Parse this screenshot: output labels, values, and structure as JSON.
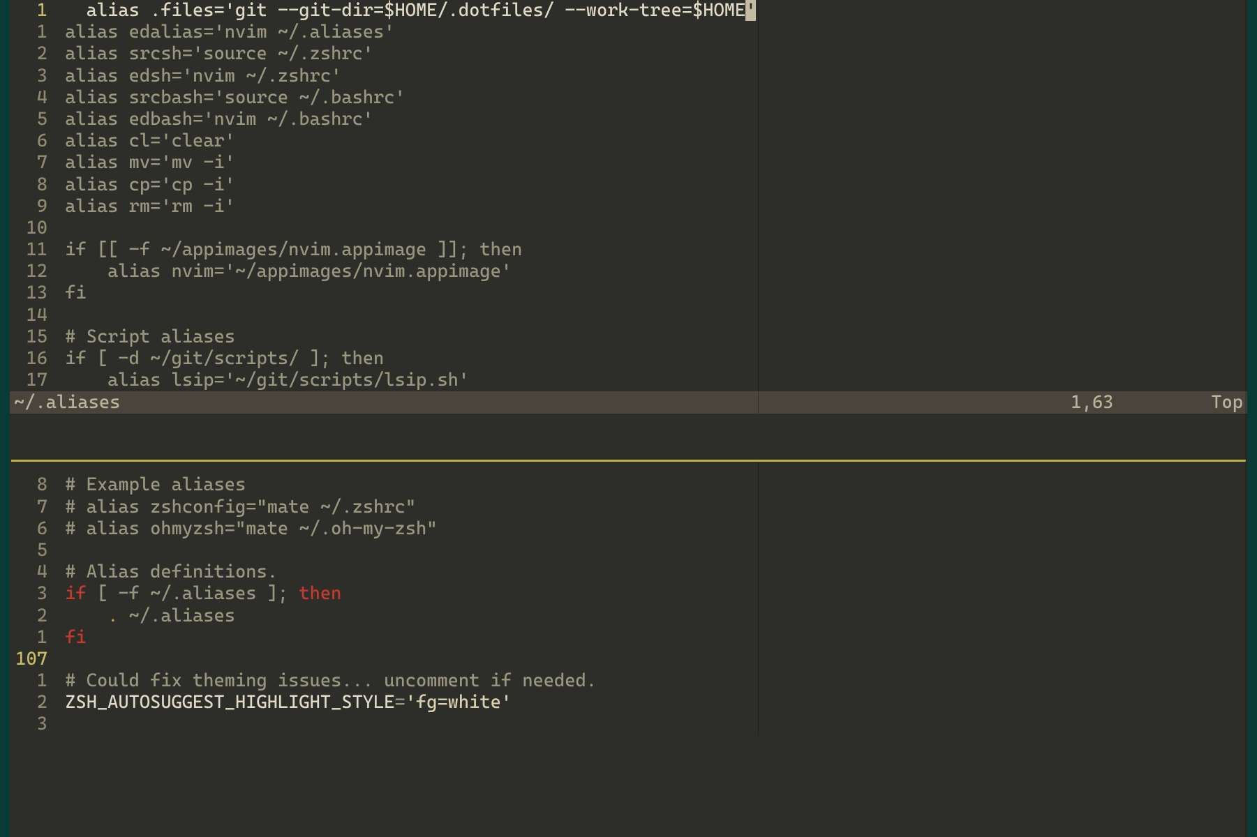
{
  "paneA": {
    "filename": "~/.aliases",
    "cursor": "1,63",
    "scroll": "Top",
    "lines": [
      {
        "gutter": "1",
        "current": true,
        "segments": [
          {
            "t": "alias .files=",
            "c": "bright"
          },
          {
            "t": "'git --git-dir=$HOME/.dotfiles/ --work-tree=$HOME",
            "c": "bright"
          },
          {
            "t": "'",
            "c": "cursor"
          }
        ],
        "indent": "   "
      },
      {
        "gutter": "1",
        "segments": [
          {
            "t": "alias edalias=",
            "c": "dim"
          },
          {
            "t": "'nvim ~/.aliases'",
            "c": "dim"
          }
        ]
      },
      {
        "gutter": "2",
        "segments": [
          {
            "t": "alias srcsh=",
            "c": "dim"
          },
          {
            "t": "'source ~/.zshrc'",
            "c": "dim"
          }
        ]
      },
      {
        "gutter": "3",
        "segments": [
          {
            "t": "alias edsh=",
            "c": "dim"
          },
          {
            "t": "'nvim ~/.zshrc'",
            "c": "dim"
          }
        ]
      },
      {
        "gutter": "4",
        "segments": [
          {
            "t": "alias srcbash=",
            "c": "dim"
          },
          {
            "t": "'source ~/.bashrc'",
            "c": "dim"
          }
        ]
      },
      {
        "gutter": "5",
        "segments": [
          {
            "t": "alias edbash=",
            "c": "dim"
          },
          {
            "t": "'nvim ~/.bashrc'",
            "c": "dim"
          }
        ]
      },
      {
        "gutter": "6",
        "segments": [
          {
            "t": "alias cl=",
            "c": "dim"
          },
          {
            "t": "'clear'",
            "c": "dim"
          }
        ]
      },
      {
        "gutter": "7",
        "segments": [
          {
            "t": "alias mv=",
            "c": "dim"
          },
          {
            "t": "'mv -i'",
            "c": "dim"
          }
        ]
      },
      {
        "gutter": "8",
        "segments": [
          {
            "t": "alias cp=",
            "c": "dim"
          },
          {
            "t": "'cp -i'",
            "c": "dim"
          }
        ]
      },
      {
        "gutter": "9",
        "segments": [
          {
            "t": "alias rm=",
            "c": "dim"
          },
          {
            "t": "'rm -i'",
            "c": "dim"
          }
        ]
      },
      {
        "gutter": "10",
        "segments": []
      },
      {
        "gutter": "11",
        "segments": [
          {
            "t": "if [[ -f ~/appimages/nvim.appimage ]]; then",
            "c": "dim"
          }
        ]
      },
      {
        "gutter": "12",
        "segments": [
          {
            "t": "    alias nvim=",
            "c": "dim"
          },
          {
            "t": "'~/appimages/nvim.appimage'",
            "c": "dim"
          }
        ]
      },
      {
        "gutter": "13",
        "segments": [
          {
            "t": "fi",
            "c": "dim"
          }
        ]
      },
      {
        "gutter": "14",
        "segments": []
      },
      {
        "gutter": "15",
        "segments": [
          {
            "t": "# Script aliases",
            "c": "dim"
          }
        ]
      },
      {
        "gutter": "16",
        "segments": [
          {
            "t": "if [ -d ~/git/scripts/ ]; then",
            "c": "dim"
          }
        ]
      },
      {
        "gutter": "17",
        "segments": [
          {
            "t": "    alias lsip=",
            "c": "dim"
          },
          {
            "t": "'~/git/scripts/lsip.sh'",
            "c": "dim"
          }
        ]
      }
    ]
  },
  "paneB": {
    "lines": [
      {
        "gutter": "8",
        "segments": [
          {
            "t": "# Example aliases",
            "c": "dim"
          }
        ]
      },
      {
        "gutter": "7",
        "segments": [
          {
            "t": "# alias zshconfig=\"mate ~/.zshrc\"",
            "c": "dim"
          }
        ]
      },
      {
        "gutter": "6",
        "segments": [
          {
            "t": "# alias ohmyzsh=\"mate ~/.oh-my-zsh\"",
            "c": "dim"
          }
        ]
      },
      {
        "gutter": "5",
        "segments": []
      },
      {
        "gutter": "4",
        "segments": [
          {
            "t": "# Alias definitions.",
            "c": "dim"
          }
        ]
      },
      {
        "gutter": "3",
        "segments": [
          {
            "t": "if",
            "c": "k-red"
          },
          {
            "t": " [ -f ~/.aliases ]; ",
            "c": "dim"
          },
          {
            "t": "then",
            "c": "k-red"
          }
        ]
      },
      {
        "gutter": "2",
        "segments": [
          {
            "t": "    ",
            "c": "dim"
          },
          {
            "t": ".",
            "c": "k-gold"
          },
          {
            "t": " ~/.aliases",
            "c": "dim"
          }
        ]
      },
      {
        "gutter": "1",
        "segments": [
          {
            "t": "fi",
            "c": "k-red"
          }
        ]
      },
      {
        "gutter": "107",
        "current": true,
        "segments": []
      },
      {
        "gutter": "1",
        "segments": [
          {
            "t": "# Could fix theming issues... uncomment if needed.",
            "c": "dim"
          }
        ]
      },
      {
        "gutter": "2",
        "segments": [
          {
            "t": "ZSH_AUTOSUGGEST_HIGHLIGHT_STYLE",
            "c": "bright"
          },
          {
            "t": "=",
            "c": "dim"
          },
          {
            "t": "'fg=white'",
            "c": "str"
          }
        ]
      },
      {
        "gutter": "3",
        "segments": []
      }
    ]
  }
}
